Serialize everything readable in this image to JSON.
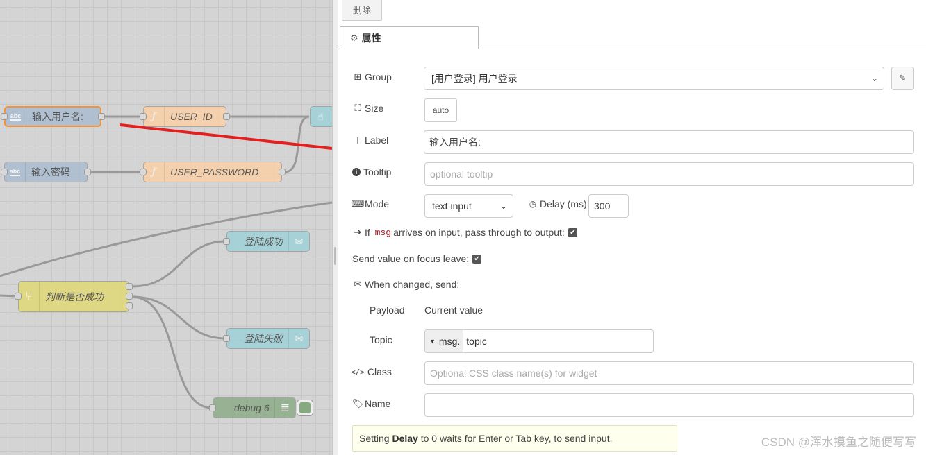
{
  "canvas": {
    "nodes": {
      "text_input_username": "输入用户名:",
      "function_user_id": "USER_ID",
      "text_input_password": "输入密码",
      "function_user_password": "USER_PASSWORD",
      "switch_check": "判断是否成功",
      "email_success": "登陆成功",
      "email_fail": "登陆失败",
      "debug": "debug 6"
    },
    "icons": {
      "text_input": "abc-icon",
      "function": "function-icon",
      "switch": "switch-icon",
      "email": "envelope-icon",
      "debug": "list-icon"
    },
    "colors": {
      "text_input": "#a6bbcf",
      "function": "#fdd0a2",
      "switch": "#e2d96e",
      "email": "#9ad2d8",
      "debug": "#87a980",
      "selected": "#ff7f0e",
      "arrow": "#e32020"
    }
  },
  "toolbar": {
    "delete_label": "删除"
  },
  "tabs": [
    {
      "label": "属性",
      "icon": "gear-icon"
    }
  ],
  "form": {
    "group": {
      "label": "Group",
      "value": "[用户登录] 用户登录",
      "icon": "table-icon"
    },
    "size": {
      "label": "Size",
      "value": "auto",
      "icon": "resize-icon"
    },
    "label": {
      "label": "Label",
      "value": "输入用户名:",
      "icon": "text-cursor-icon"
    },
    "tooltip": {
      "label": "Tooltip",
      "placeholder": "optional tooltip",
      "icon": "info-icon"
    },
    "mode": {
      "label": "Mode",
      "value": "text input",
      "icon": "keyboard-icon"
    },
    "delay": {
      "label": "Delay (ms)",
      "value": "300",
      "icon": "clock-icon"
    },
    "passthrough": {
      "prefix": "If",
      "code": "msg",
      "suffix": "arrives on input, pass through to output:",
      "checked": true
    },
    "focus_leave": {
      "label": "Send value on focus leave:",
      "checked": true
    },
    "when_changed": {
      "label": "When changed, send:",
      "icon": "envelope-icon"
    },
    "payload": {
      "label": "Payload",
      "value": "Current value"
    },
    "topic": {
      "label": "Topic",
      "prefix": "msg.",
      "value": "topic"
    },
    "class": {
      "label": "Class",
      "placeholder": "Optional CSS class name(s) for widget",
      "icon": "code-icon"
    },
    "name": {
      "label": "Name",
      "value": "",
      "icon": "tag-icon"
    }
  },
  "tip": {
    "before": "Setting",
    "bold": "Delay",
    "after": "to 0 waits for Enter or Tab key, to send input."
  },
  "watermark": "CSDN @浑水摸鱼之随便写写"
}
